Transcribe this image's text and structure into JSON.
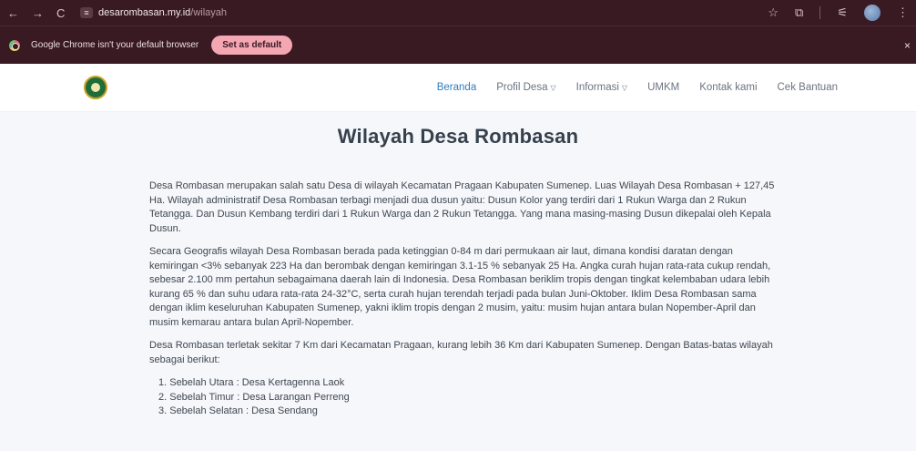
{
  "browser": {
    "url_domain": "desarombasan.my.id",
    "url_path": "/wilayah",
    "nav": {
      "back": "←",
      "forward": "→",
      "reload": "C"
    },
    "icons": {
      "star": "☆",
      "tabs": "⧉",
      "extensions": "⚟"
    }
  },
  "infobar": {
    "message": "Google Chrome isn't your default browser",
    "button": "Set as default",
    "close": "×"
  },
  "site": {
    "menu": {
      "beranda": "Beranda",
      "profil": "Profil Desa",
      "informasi": "Informasi",
      "umkm": "UMKM",
      "kontak": "Kontak kami",
      "bantuan": "Cek Bantuan"
    }
  },
  "page": {
    "title": "Wilayah Desa Rombasan",
    "p1": "Desa Rombasan merupakan salah satu Desa di wilayah Kecamatan Pragaan Kabupaten Sumenep. Luas Wilayah Desa Rombasan + 127,45 Ha. Wilayah administratif Desa Rombasan terbagi menjadi dua dusun yaitu: Dusun Kolor yang terdiri dari 1 Rukun Warga dan 2 Rukun Tetangga. Dan Dusun Kembang terdiri dari 1 Rukun Warga dan 2 Rukun Tetangga. Yang mana masing-masing Dusun dikepalai oleh Kepala Dusun.",
    "p2": "Secara Geografis wilayah Desa Rombasan berada pada ketinggian 0-84 m dari permukaan air laut, dimana kondisi daratan dengan kemiringan <3% sebanyak 223 Ha dan berombak dengan kemiringan 3.1-15 % sebanyak 25 Ha. Angka curah hujan rata-rata cukup rendah, sebesar 2.100 mm pertahun sebagaimana daerah lain di Indonesia. Desa Rombasan beriklim tropis dengan tingkat kelembaban udara lebih kurang 65 % dan suhu udara rata-rata 24-32°C, serta curah hujan terendah terjadi pada bulan Juni-Oktober. Iklim Desa Rombasan sama dengan iklim keseluruhan Kabupaten Sumenep, yakni iklim tropis dengan 2 musim, yaitu: musim hujan antara bulan Nopember-April dan musim kemarau antara bulan April-Nopember.",
    "p3": "Desa Rombasan terletak sekitar 7 Km dari Kecamatan Pragaan, kurang lebih 36 Km dari Kabupaten Sumenep. Dengan Batas-batas wilayah sebagai berikut:",
    "borders": [
      "1. Sebelah Utara : Desa Kertagenna Laok",
      "2. Sebelah Timur : Desa Larangan Perreng",
      "3. Sebelah Selatan : Desa Sendang"
    ]
  }
}
